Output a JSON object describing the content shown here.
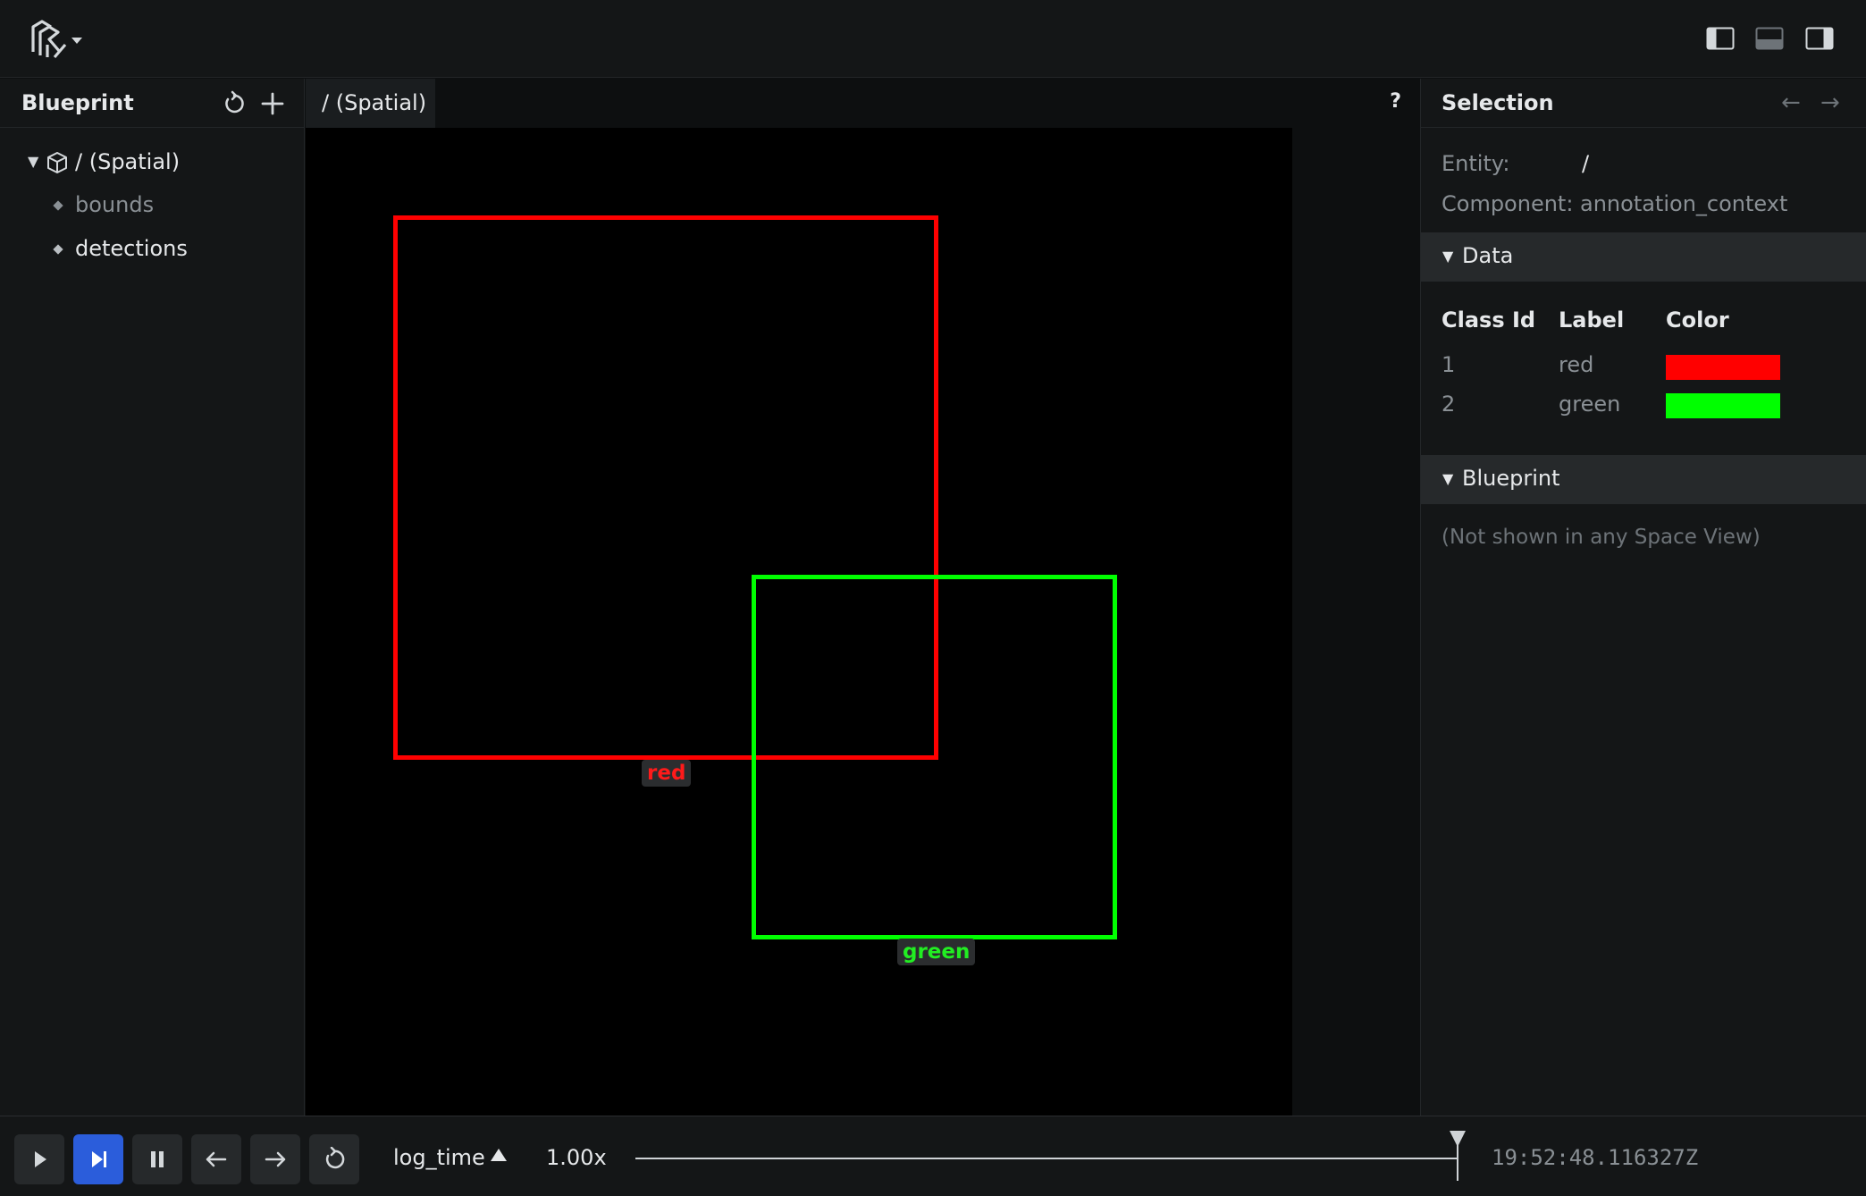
{
  "topbar": {
    "logo_icon": "rerun-logo-icon",
    "layout_buttons": [
      "left-panel-toggle-icon",
      "bottom-panel-toggle-icon",
      "right-panel-toggle-icon"
    ]
  },
  "blueprint_panel": {
    "title": "Blueprint",
    "reset_icon": "reset-icon",
    "add_icon": "plus-icon",
    "tree": {
      "root": {
        "label": "/ (Spatial)",
        "icon": "cube-icon"
      },
      "children": [
        {
          "label": "bounds",
          "dimmed": true
        },
        {
          "label": "detections",
          "dimmed": false
        }
      ]
    }
  },
  "viewport": {
    "tab_label": "/ (Spatial)",
    "help_label": "?",
    "boxes": [
      {
        "label": "red",
        "color": "#ff0000"
      },
      {
        "label": "green",
        "color": "#00ff00"
      }
    ]
  },
  "selection": {
    "title": "Selection",
    "back_icon": "←",
    "forward_icon": "→",
    "entity_key": "Entity:",
    "entity_value": "/",
    "component_key": "Component:",
    "component_value": "annotation_context",
    "data_section": {
      "title": "Data",
      "columns": [
        "Class Id",
        "Label",
        "Color"
      ],
      "rows": [
        {
          "class_id": "1",
          "label": "red",
          "color": "#ff0000"
        },
        {
          "class_id": "2",
          "label": "green",
          "color": "#00ff00"
        }
      ]
    },
    "blueprint_section": {
      "title": "Blueprint",
      "note": "(Not shown in any Space View)"
    }
  },
  "time_panel": {
    "controls": [
      "play-icon",
      "step-icon",
      "pause-icon",
      "arrow-left-icon",
      "arrow-right-icon",
      "loop-icon"
    ],
    "active_control": "step-icon",
    "timeline": "log_time",
    "speed": "1.00x",
    "timestamp": "19:52:48.116327Z"
  }
}
